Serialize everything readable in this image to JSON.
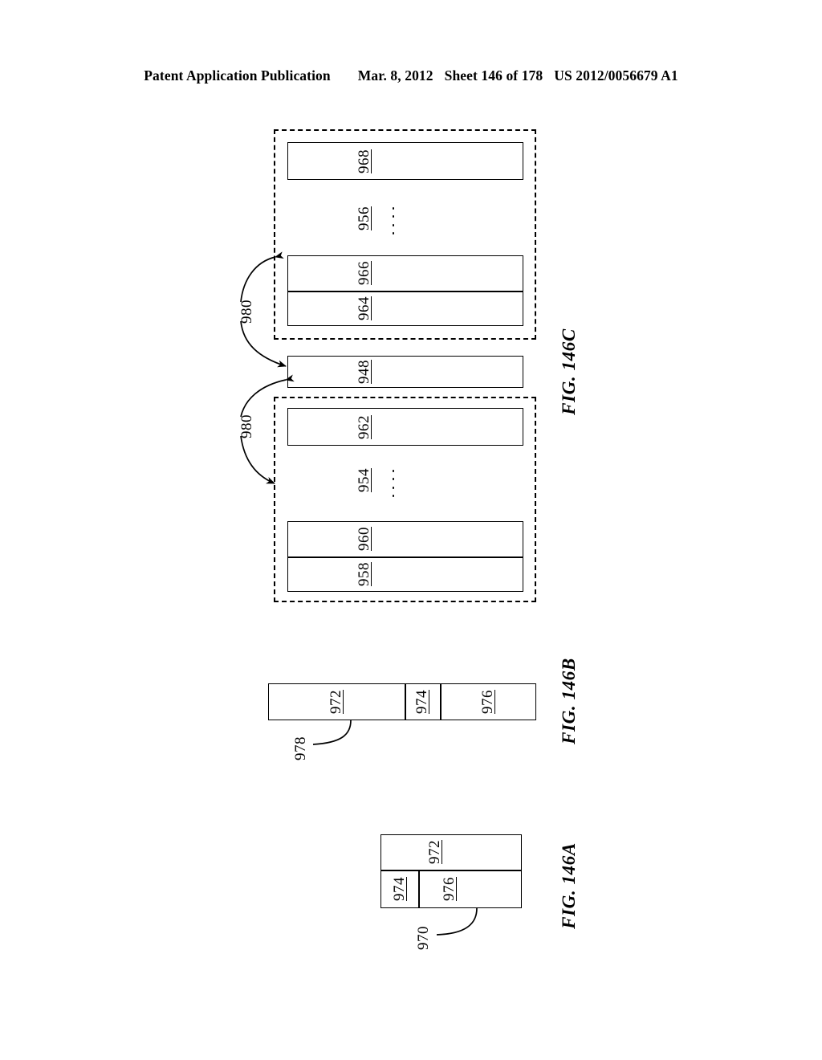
{
  "header": {
    "publication": "Patent Application Publication",
    "date": "Mar. 8, 2012",
    "sheet": "Sheet 146 of 178",
    "patent_number": "US 2012/0056679 A1"
  },
  "figures": {
    "fig_146c": {
      "label": "FIG. 146C",
      "upper_group": {
        "top_box_ref": "968",
        "group_ref": "956",
        "ellipsis": "...",
        "stacked_box_upper_ref": "966",
        "stacked_box_lower_ref": "964"
      },
      "middle_box_ref": "948",
      "lower_group": {
        "top_box_ref": "962",
        "group_ref": "954",
        "ellipsis": "...",
        "stacked_box_upper_ref": "960",
        "stacked_box_lower_ref": "958"
      },
      "connector_upper_ref": "980",
      "connector_lower_ref": "980"
    },
    "fig_146b": {
      "label": "FIG. 146B",
      "cells": [
        {
          "ref": "972"
        },
        {
          "ref": "974"
        },
        {
          "ref": "976"
        }
      ],
      "leader_ref": "978"
    },
    "fig_146a": {
      "label": "FIG. 146A",
      "top_row": {
        "ref": "972"
      },
      "bottom_row_left": {
        "ref": "974"
      },
      "bottom_row_right": {
        "ref": "976"
      },
      "leader_ref": "970"
    }
  },
  "colors": {
    "ink": "#000000",
    "paper": "#ffffff"
  }
}
